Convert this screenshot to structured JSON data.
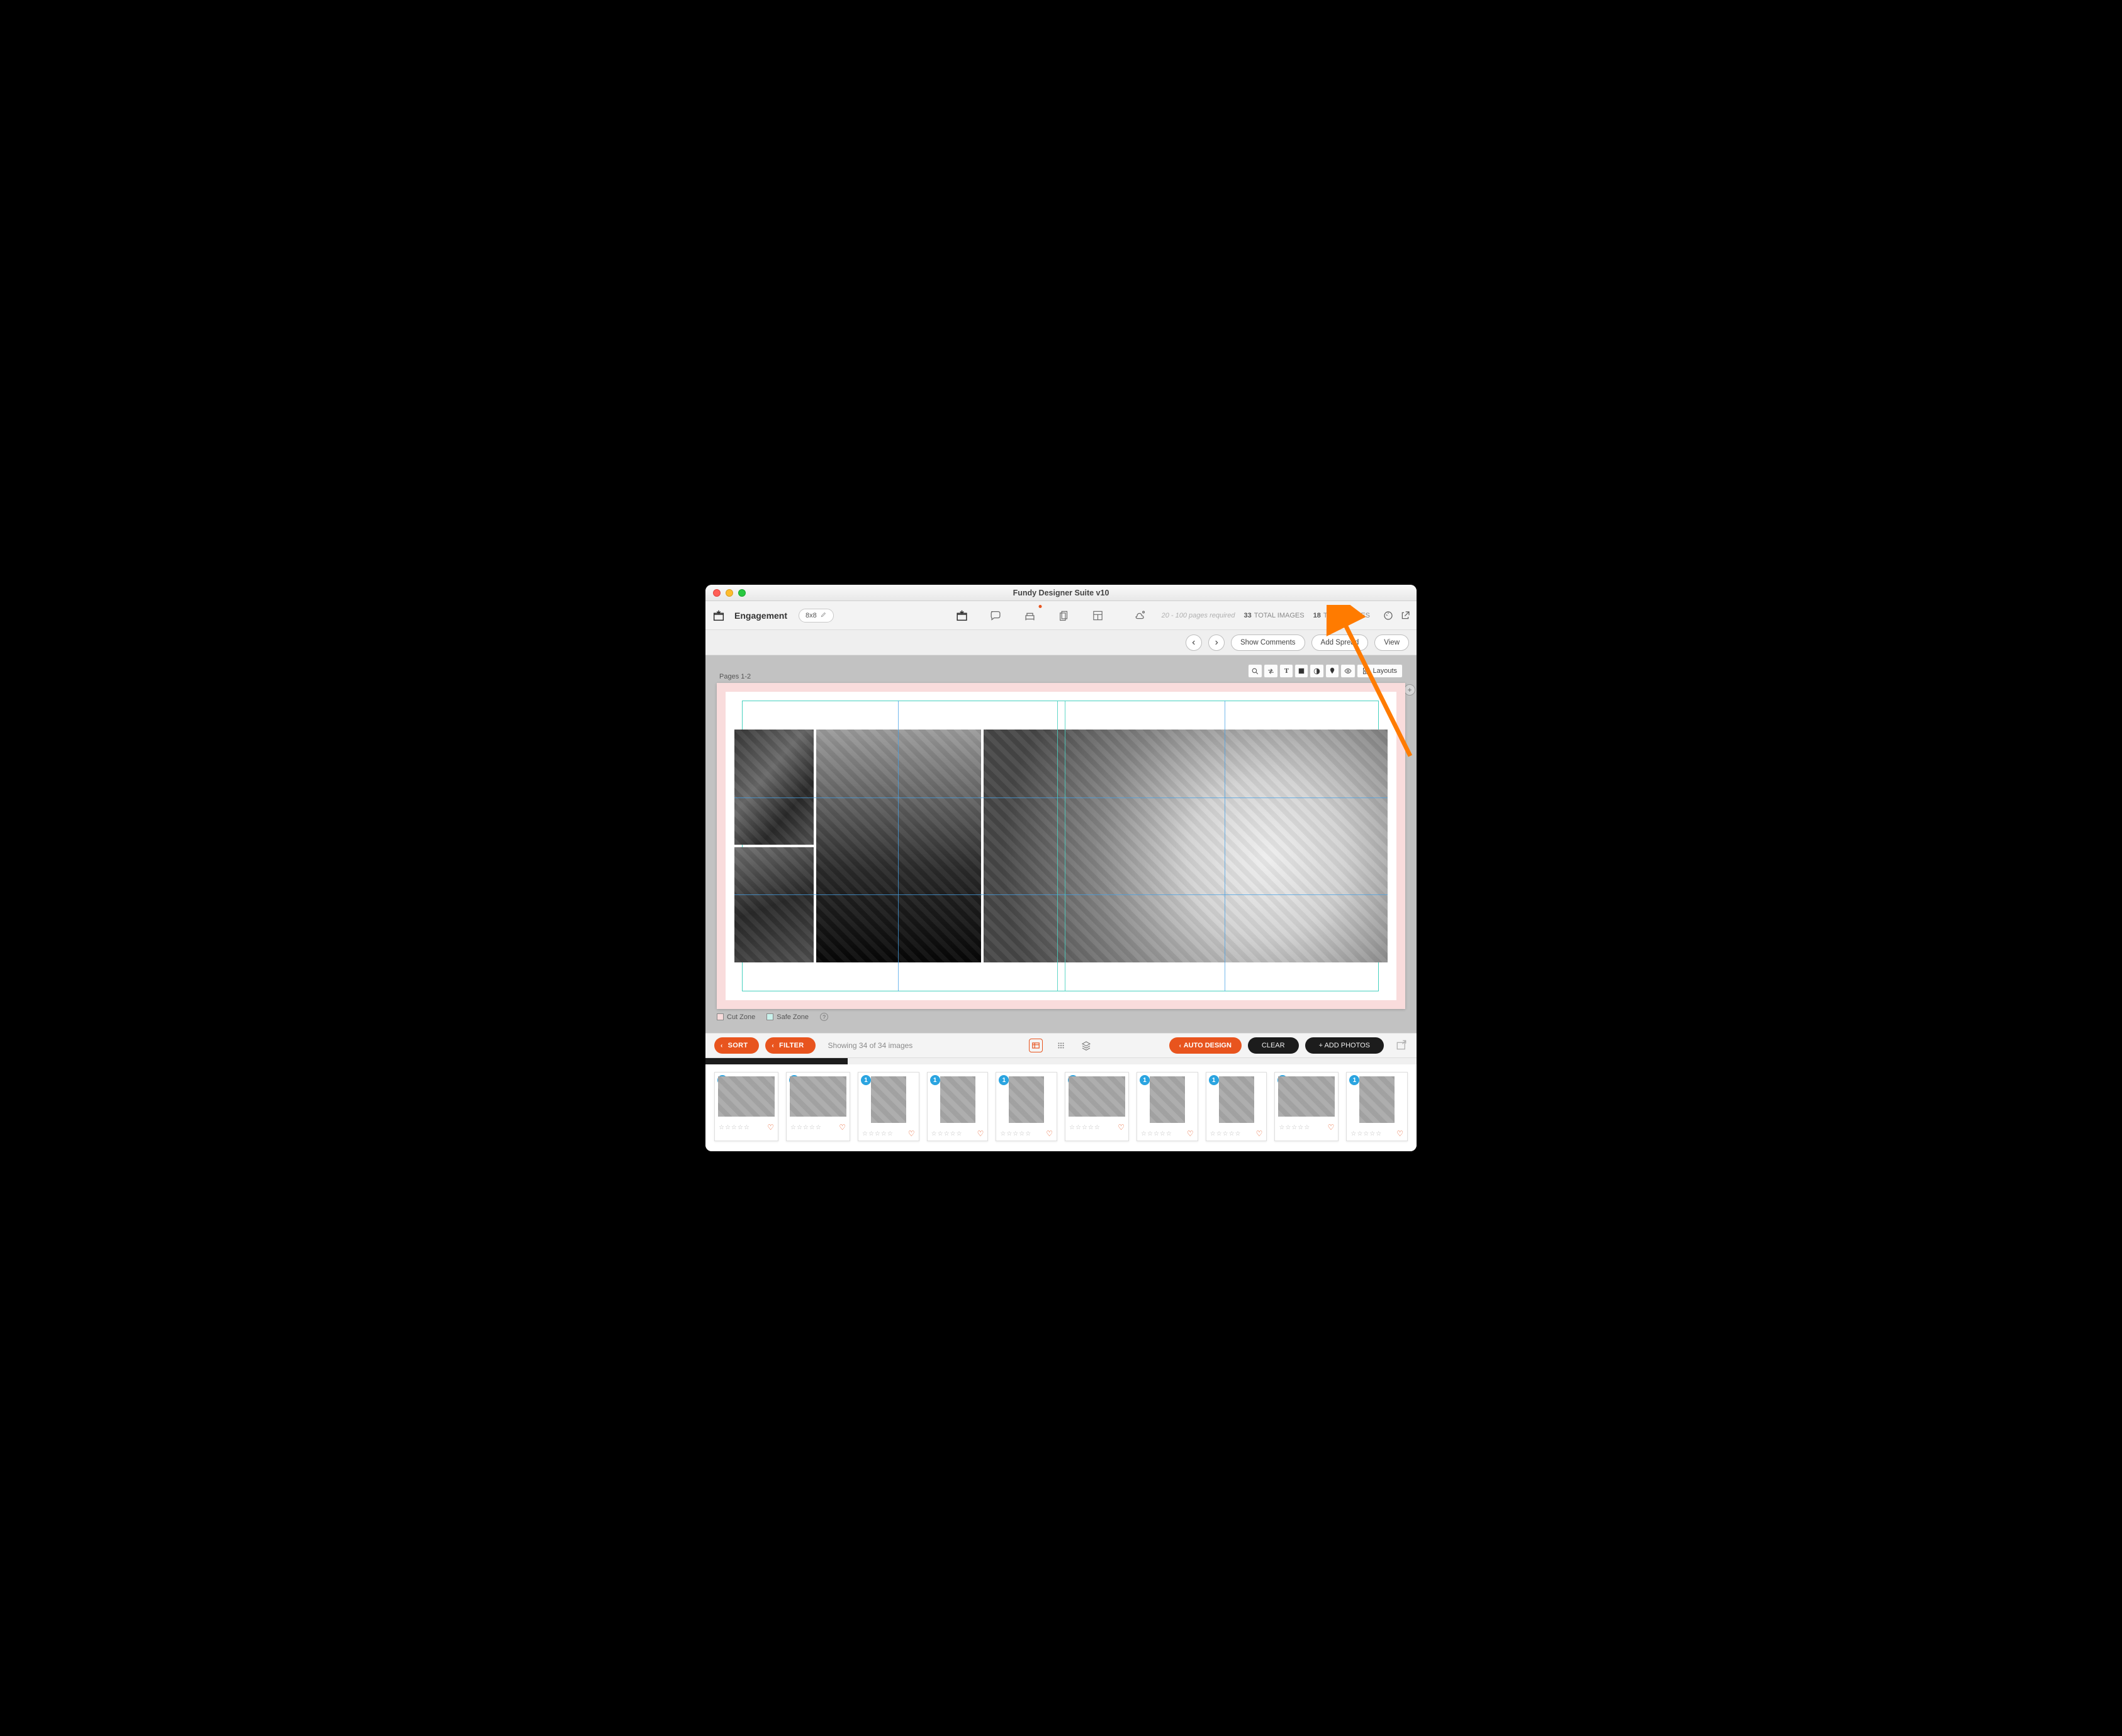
{
  "window": {
    "title": "Fundy Designer Suite v10"
  },
  "toolbar": {
    "project_name": "Engagement",
    "size_label": "8x8",
    "pages_requirement": "20 - 100 pages required",
    "total_images_count": "33",
    "total_images_label": "TOTAL IMAGES",
    "total_pages_count": "18",
    "total_pages_label": "TOTAL PAGES"
  },
  "actions": {
    "show_comments": "Show Comments",
    "add_spread": "Add Spread",
    "view": "View"
  },
  "canvas": {
    "pages_label": "Pages 1-2",
    "layouts_label": "Layouts",
    "legend": {
      "cut_zone": "Cut Zone",
      "safe_zone": "Safe Zone"
    }
  },
  "strip": {
    "sort_label": "SORT",
    "filter_label": "FILTER",
    "showing": "Showing 34 of 34 images",
    "auto_design": "AUTO DESIGN",
    "clear": "CLEAR",
    "add_photos": "+ ADD PHOTOS"
  },
  "thumbs": {
    "badge": "1",
    "items": [
      {
        "orient": "land"
      },
      {
        "orient": "land"
      },
      {
        "orient": "port"
      },
      {
        "orient": "port"
      },
      {
        "orient": "port"
      },
      {
        "orient": "land"
      },
      {
        "orient": "port"
      },
      {
        "orient": "port"
      },
      {
        "orient": "land"
      },
      {
        "orient": "port"
      }
    ]
  }
}
